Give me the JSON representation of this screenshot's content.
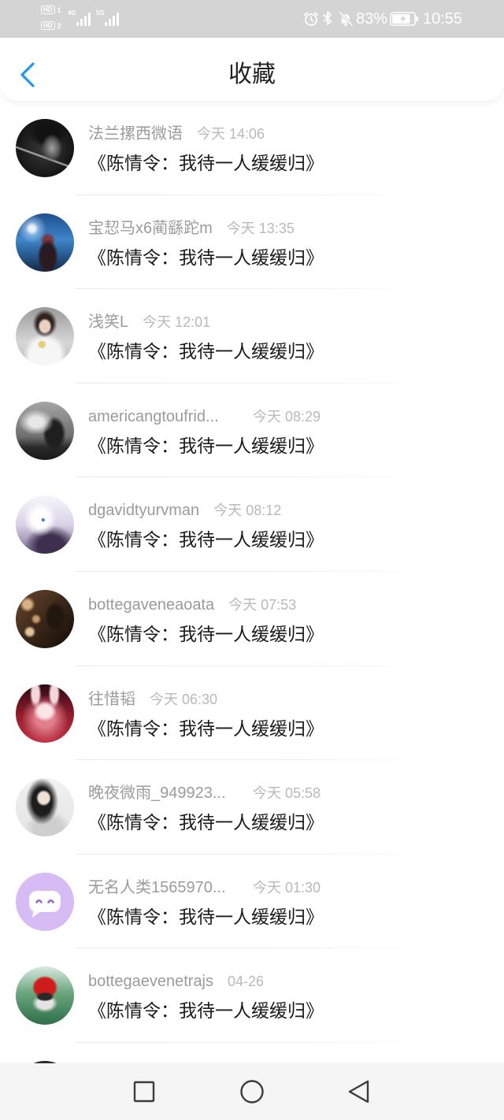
{
  "status_bar": {
    "sim1": {
      "badge": "HD",
      "index": "1"
    },
    "sim2": {
      "badge": "HD",
      "index": "2"
    },
    "network1": "4G",
    "network2": "5G",
    "battery_text": "83%",
    "battery_level": 0.83,
    "time": "10:55",
    "icons": [
      "alarm-icon",
      "bluetooth-icon",
      "bell-off-icon",
      "battery-charging-icon"
    ]
  },
  "header": {
    "title": "收藏",
    "back_icon": "chevron-left-icon"
  },
  "items": [
    {
      "name": "法兰摞西微语",
      "time": "今天 14:06",
      "title": "《陈情令：我待一人缓缓归》"
    },
    {
      "name": "宝恝马x6蔺繇跎m",
      "time": "今天 13:35",
      "title": "《陈情令：我待一人缓缓归》"
    },
    {
      "name": "浅笑L",
      "time": "今天 12:01",
      "title": "《陈情令：我待一人缓缓归》"
    },
    {
      "name": "americangtoufrid...",
      "time": "今天 08:29",
      "title": "《陈情令：我待一人缓缓归》"
    },
    {
      "name": "dgavidtyurvman",
      "time": "今天 08:12",
      "title": "《陈情令：我待一人缓缓归》"
    },
    {
      "name": "bottegaveneaoata",
      "time": "今天 07:53",
      "title": "《陈情令：我待一人缓缓归》"
    },
    {
      "name": "往惜韬",
      "time": "今天 06:30",
      "title": "《陈情令：我待一人缓缓归》"
    },
    {
      "name": "晚夜微雨_949923...",
      "time": "今天 05:58",
      "title": "《陈情令：我待一人缓缓归》"
    },
    {
      "name": "无名人类1565970...",
      "time": "今天 01:30",
      "title": "《陈情令：我待一人缓缓归》"
    },
    {
      "name": "bottegaevenetrajs",
      "time": "04-26",
      "title": "《陈情令：我待一人缓缓归》"
    }
  ],
  "nav_bar": {
    "icons": [
      "recent-apps-icon",
      "home-icon",
      "back-icon"
    ]
  },
  "colors": {
    "accent": "#2196f3",
    "status_bar_bg": "#d4d4d4",
    "name_text": "#9b9b9b",
    "time_text": "#b9b9b9",
    "title_text": "#1b1b1b",
    "nav_bg": "#f5f5f5",
    "default_avatar_bg": "#d7bbf5"
  }
}
